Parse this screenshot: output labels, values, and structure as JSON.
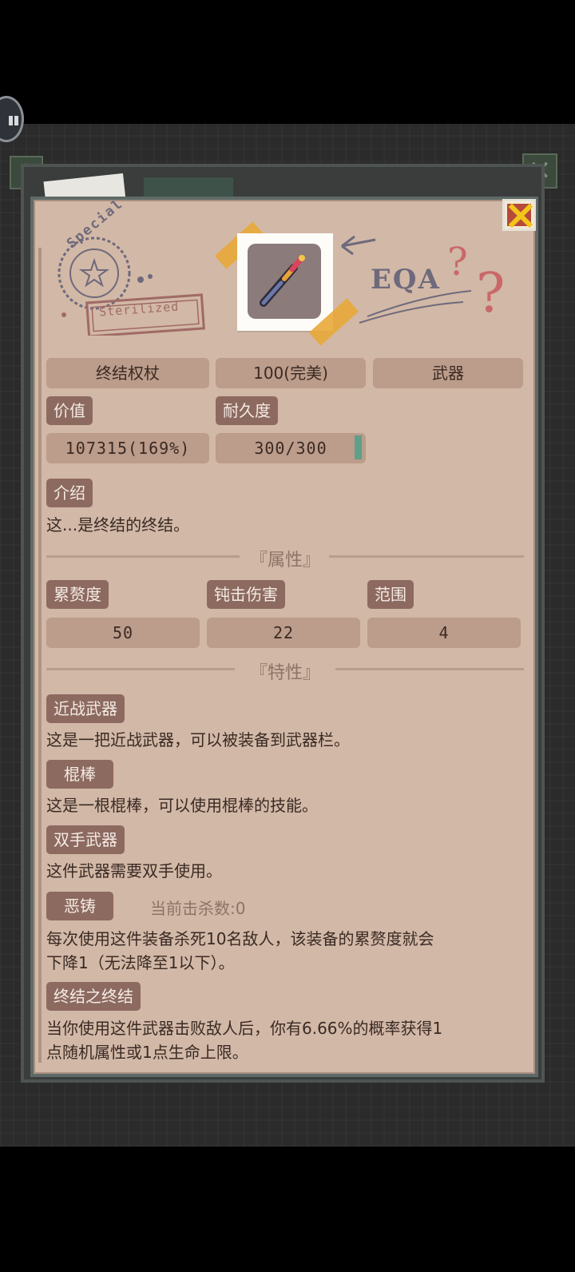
{
  "item": {
    "name": "终结权杖",
    "quality": "100(完美)",
    "category": "武器"
  },
  "value": {
    "label": "价值",
    "amount": "107315(169%)"
  },
  "durability": {
    "label": "耐久度",
    "amount": "300/300",
    "fraction": 1.0
  },
  "intro": {
    "label": "介绍",
    "text": "这...是终结的终结。"
  },
  "attributes": {
    "section_title": "『属性』",
    "items": [
      {
        "label": "累赘度",
        "value": "50"
      },
      {
        "label": "钝击伤害",
        "value": "22"
      },
      {
        "label": "范围",
        "value": "4"
      }
    ]
  },
  "traits": {
    "section_title": "『特性』",
    "items": [
      {
        "label": "近战武器",
        "desc": "这是一把近战武器，可以被装备到武器栏。"
      },
      {
        "label": "棍棒",
        "desc": "这是一根棍棒，可以使用棍棒的技能。"
      },
      {
        "label": "双手武器",
        "desc": "这件武器需要双手使用。"
      },
      {
        "label": "恶铸",
        "extra": "当前击杀数:0",
        "desc_line1": "每次使用这件装备杀死10名敌人，该装备的累赘度就会",
        "desc_line2": "下降1（无法降至1以下）。"
      },
      {
        "label": "终结之终结",
        "desc_line1": "当你使用这件武器击败敌人后，你有6.66%的概率获得1",
        "desc_line2": "点随机属性或1点生命上限。"
      }
    ]
  },
  "stamp": {
    "circle_text": "Special",
    "box_text": "Sterilized"
  },
  "scribble": {
    "text": "EQA"
  },
  "background_icons": {
    "help": "?",
    "close": "✕"
  },
  "colors": {
    "panel": "#d2b8a6",
    "pill": "#bc9c8a",
    "tag": "#8d6a60",
    "accent_green": "#5fa08a",
    "close_red": "#b54a3a",
    "close_yellow": "#f2c51a"
  },
  "icons": {
    "close": "close-icon",
    "item": "scepter-icon",
    "pause": "pause-icon"
  }
}
